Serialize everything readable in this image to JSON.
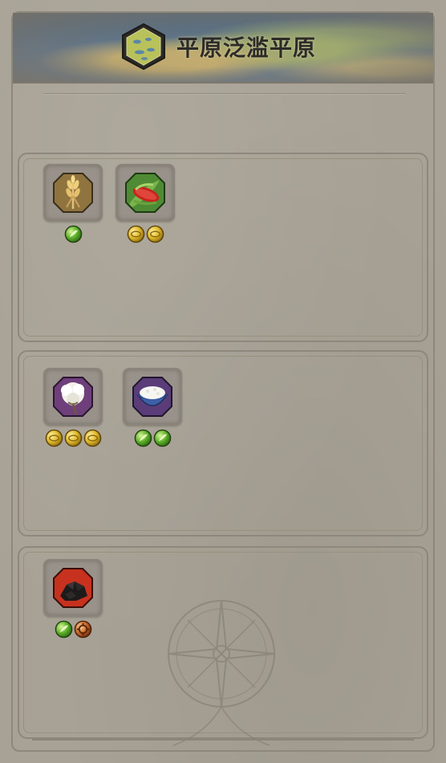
{
  "header": {
    "title": "平原泛滥平原",
    "badge_icon": "floodplains-tile-icon"
  },
  "sections": [
    {
      "resources": [
        {
          "icon": "wheat-icon",
          "bg_color": "#8f7440",
          "yields": [
            "food-icon"
          ]
        },
        {
          "icon": "maize-icon",
          "bg_color": "#4f8a35",
          "yields": [
            "gold-icon",
            "gold-icon"
          ]
        }
      ]
    },
    {
      "resources": [
        {
          "icon": "cotton-icon",
          "bg_color": "#6e3f7a",
          "yields": [
            "gold-icon",
            "gold-icon",
            "gold-icon"
          ]
        },
        {
          "icon": "rice-icon",
          "bg_color": "#5a3d78",
          "yields": [
            "food-icon",
            "food-icon"
          ]
        }
      ]
    },
    {
      "resources": [
        {
          "icon": "coal-icon",
          "bg_color": "#c7321e",
          "yields": [
            "food-icon",
            "production-icon"
          ]
        }
      ]
    }
  ],
  "colors": {
    "food": "#5fb12c",
    "gold": "#e0b82a",
    "production": "#c8682a",
    "panel": "#a8a296"
  }
}
